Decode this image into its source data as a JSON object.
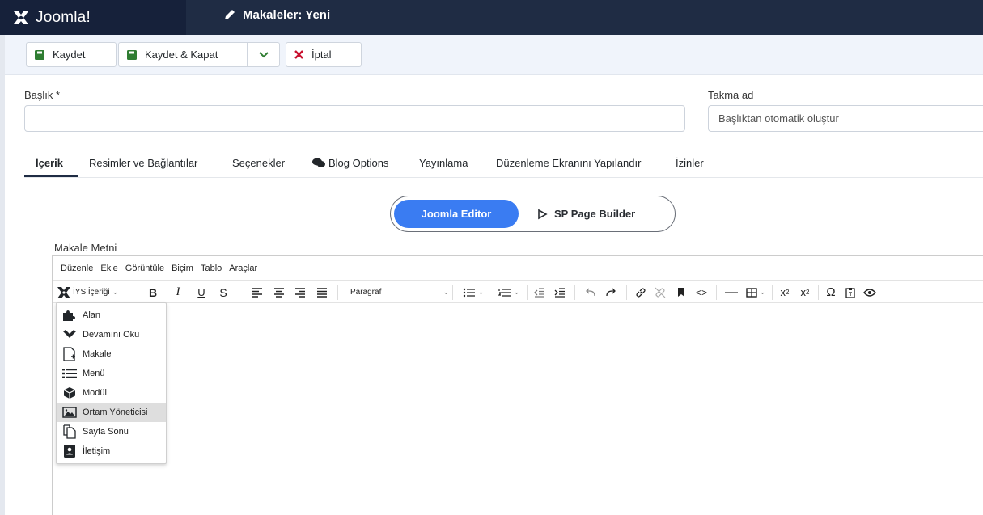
{
  "header": {
    "brand": "Joomla!",
    "title": "Makaleler: Yeni"
  },
  "toolbar": {
    "save": "Kaydet",
    "save_close": "Kaydet & Kapat",
    "cancel": "İptal"
  },
  "form": {
    "title_label": "Başlık *",
    "title_value": "",
    "alias_label": "Takma ad",
    "alias_placeholder": "Başlıktan otomatik oluştur"
  },
  "tabs": [
    {
      "label": "İçerik",
      "active": true
    },
    {
      "label": "Resimler ve Bağlantılar"
    },
    {
      "label": "Seçenekler"
    },
    {
      "label": "Blog Options"
    },
    {
      "label": "Yayınlama"
    },
    {
      "label": "Düzenleme Ekranını Yapılandır"
    },
    {
      "label": "İzinler"
    }
  ],
  "editor_switch": {
    "active": "Joomla Editor",
    "other": "SP Page Builder"
  },
  "editor": {
    "label": "Makale Metni",
    "menubar": [
      "Düzenle",
      "Ekle",
      "Görüntüle",
      "Biçim",
      "Tablo",
      "Araçlar"
    ],
    "cms_content_label": "İYS İçeriği",
    "block_format": "Paragraf",
    "dropdown_items": [
      {
        "label": "Alan",
        "icon": "puzzle-icon"
      },
      {
        "label": "Devamını Oku",
        "icon": "chevron-down-icon"
      },
      {
        "label": "Makale",
        "icon": "file-add-icon"
      },
      {
        "label": "Menü",
        "icon": "list-icon"
      },
      {
        "label": "Modül",
        "icon": "cube-icon"
      },
      {
        "label": "Ortam Yöneticisi",
        "icon": "image-icon",
        "highlighted": true
      },
      {
        "label": "Sayfa Sonu",
        "icon": "copy-icon"
      },
      {
        "label": "İletişim",
        "icon": "address-card-icon"
      }
    ]
  },
  "colors": {
    "header_bg": "#1f2c44",
    "brand_bg": "#16213a",
    "toolbar_bg": "#f0f4fb",
    "switch_active": "#3a7cf2",
    "save_icon": "#2f7d32",
    "cancel_icon": "#c8102e"
  }
}
